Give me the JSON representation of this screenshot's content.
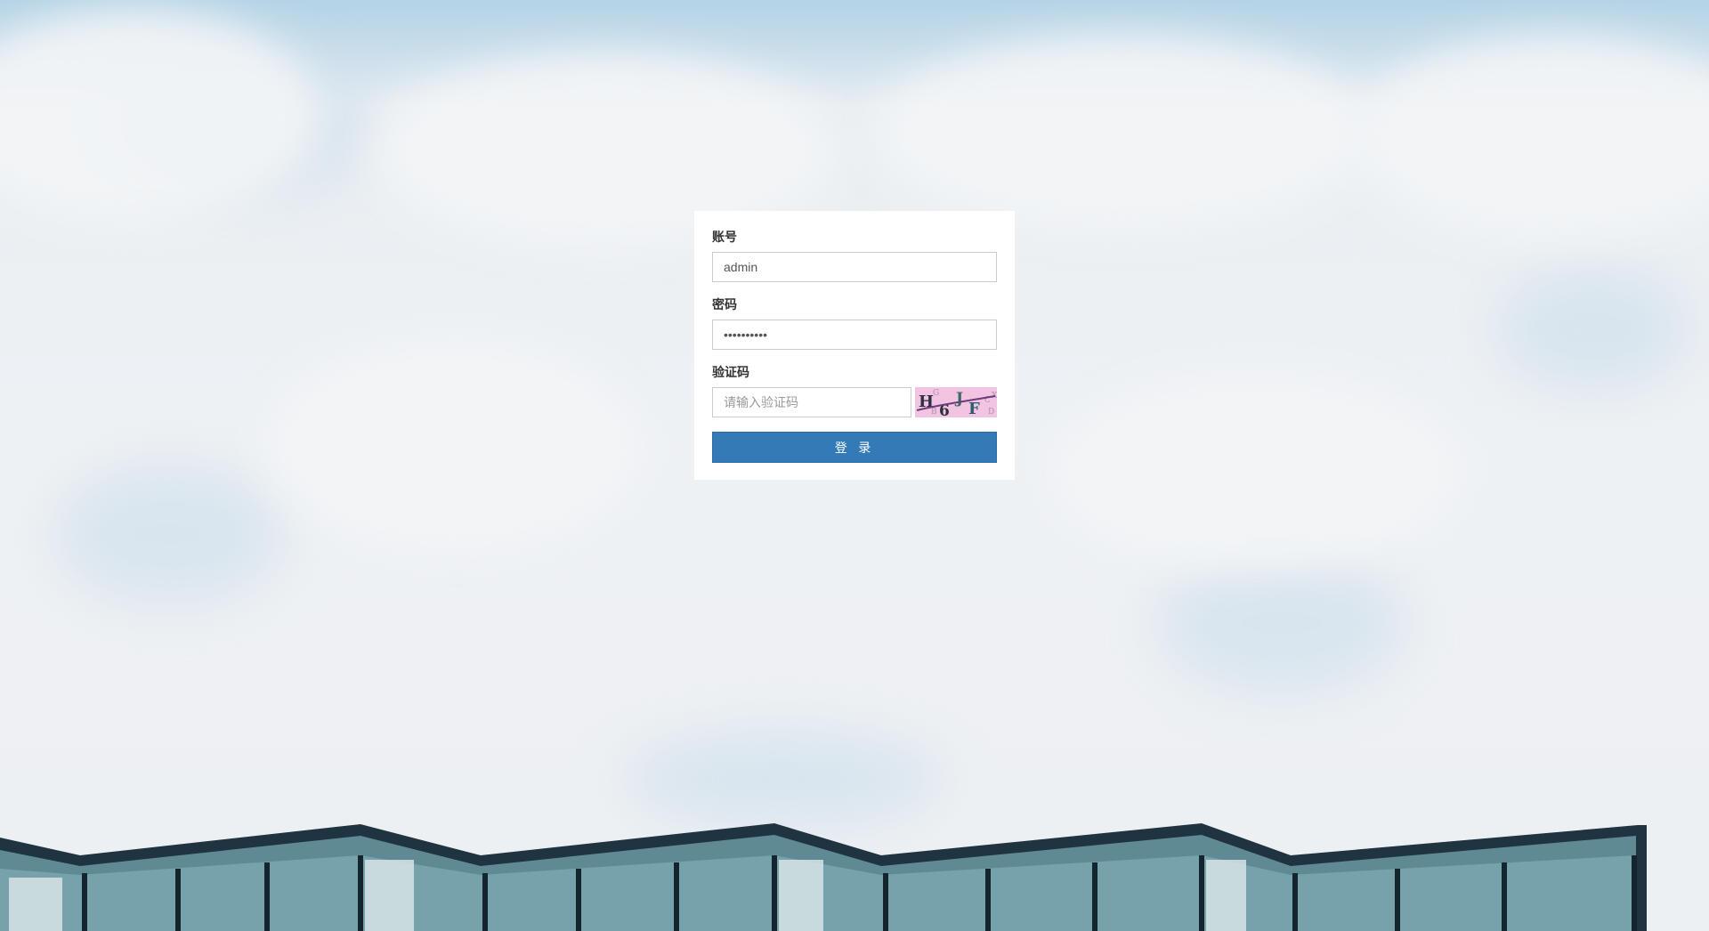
{
  "form": {
    "account": {
      "label": "账号",
      "value": "admin",
      "placeholder": ""
    },
    "password": {
      "label": "密码",
      "value": "••••••••••",
      "placeholder": ""
    },
    "captcha": {
      "label": "验证码",
      "value": "",
      "placeholder": "请输入验证码",
      "image_text": "H6JF"
    },
    "submit_label": "登 录"
  },
  "colors": {
    "button": "#337ab7",
    "card": "#ffffff",
    "sky": "#b4d3e6",
    "captcha_bg": "#f2c4e2"
  },
  "background": {
    "description_icon": "cloudy-sky-building-background"
  }
}
